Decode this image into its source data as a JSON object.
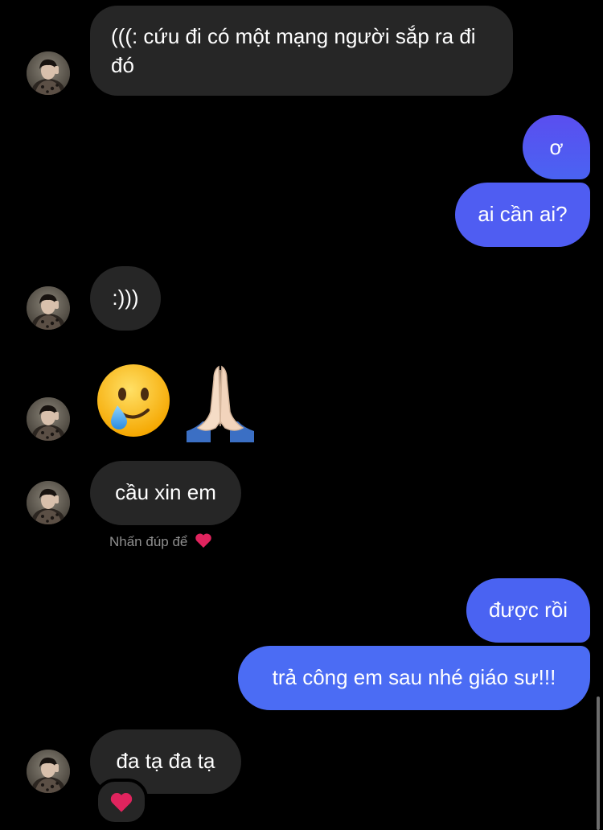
{
  "messages": [
    {
      "from": "them",
      "text": "(((: cứu đi có một mạng người sắp ra đi đó"
    },
    {
      "from": "me",
      "text": "ơ"
    },
    {
      "from": "me",
      "text": "ai cần ai?"
    },
    {
      "from": "them",
      "text": ":)))"
    },
    {
      "from": "them",
      "emojis": [
        "crying-smile-emoji",
        "praying-hands-emoji"
      ]
    },
    {
      "from": "them",
      "text": "cầu xin em"
    },
    {
      "from": "me",
      "text": "được rồi"
    },
    {
      "from": "me",
      "text": "trả công em sau nhé giáo sư!!!"
    },
    {
      "from": "them",
      "text": "đa tạ đa tạ",
      "reaction": "heart-emoji"
    }
  ],
  "hint": {
    "text": "Nhấn đúp để",
    "icon": "heart-emoji"
  },
  "colors": {
    "background": "#000000",
    "received_bubble": "#262626",
    "sent_bubble": "#4b6cf4",
    "heart": "#e0245e"
  }
}
